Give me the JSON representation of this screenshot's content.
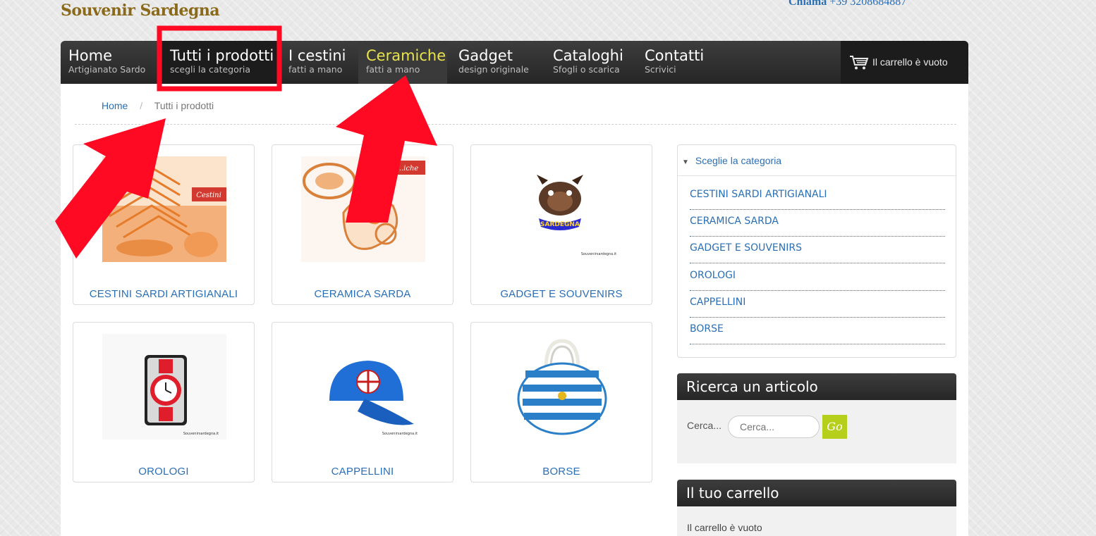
{
  "header": {
    "logo": "Souvenir Sardegna",
    "phone_label": "Chiama",
    "phone_number": "+39 3208684887"
  },
  "nav": [
    {
      "title": "Home",
      "subtitle": "Artigianato Sardo"
    },
    {
      "title": "Tutti i prodotti",
      "subtitle": "scegli la categoria"
    },
    {
      "title": "I cestini",
      "subtitle": "fatti a mano"
    },
    {
      "title": "Ceramiche",
      "subtitle": "fatti a mano"
    },
    {
      "title": "Gadget",
      "subtitle": "design originale"
    },
    {
      "title": "Cataloghi",
      "subtitle": "Sfogli o scarica"
    },
    {
      "title": "Contatti",
      "subtitle": "Scrivici"
    }
  ],
  "cart_header": "Il carrello è vuoto",
  "breadcrumb": {
    "home": "Home",
    "separator": "/",
    "current": "Tutti i prodotti"
  },
  "products": [
    {
      "label": "CESTINI SARDI ARTIGIANALI",
      "image_badge": "Cestini"
    },
    {
      "label": "CERAMICA SARDA",
      "image_badge": "...iche"
    },
    {
      "label": "GADGET E SOUVENIRS",
      "image_caption": "Souvenirsardegna.it",
      "image_text": "SARDEGNA"
    },
    {
      "label": "OROLOGI",
      "image_caption": "Souvenirsardegna.it"
    },
    {
      "label": "CAPPELLINI",
      "image_caption": "Souvenirsardegna.it"
    },
    {
      "label": "BORSE"
    }
  ],
  "sidebar": {
    "category_title": "Sceglie la categoria",
    "categories": [
      "CESTINI SARDI ARTIGIANALI",
      "CERAMICA SARDA",
      "GADGET E SOUVENIRS",
      "OROLOGI",
      "CAPPELLINI",
      "BORSE"
    ],
    "search_title": "Ricerca un articolo",
    "search_label": "Cerca...",
    "search_placeholder": "Cerca...",
    "go_label": "Go",
    "cart_title": "Il tuo carrello",
    "cart_empty": "Il carrello è vuoto"
  },
  "colors": {
    "link": "#2a6fb6",
    "nav_bg": "#2f2f2f",
    "highlight_yellow": "#e9e34c",
    "go_button": "#b5cf1a",
    "annotation_red": "#ff0a22"
  }
}
